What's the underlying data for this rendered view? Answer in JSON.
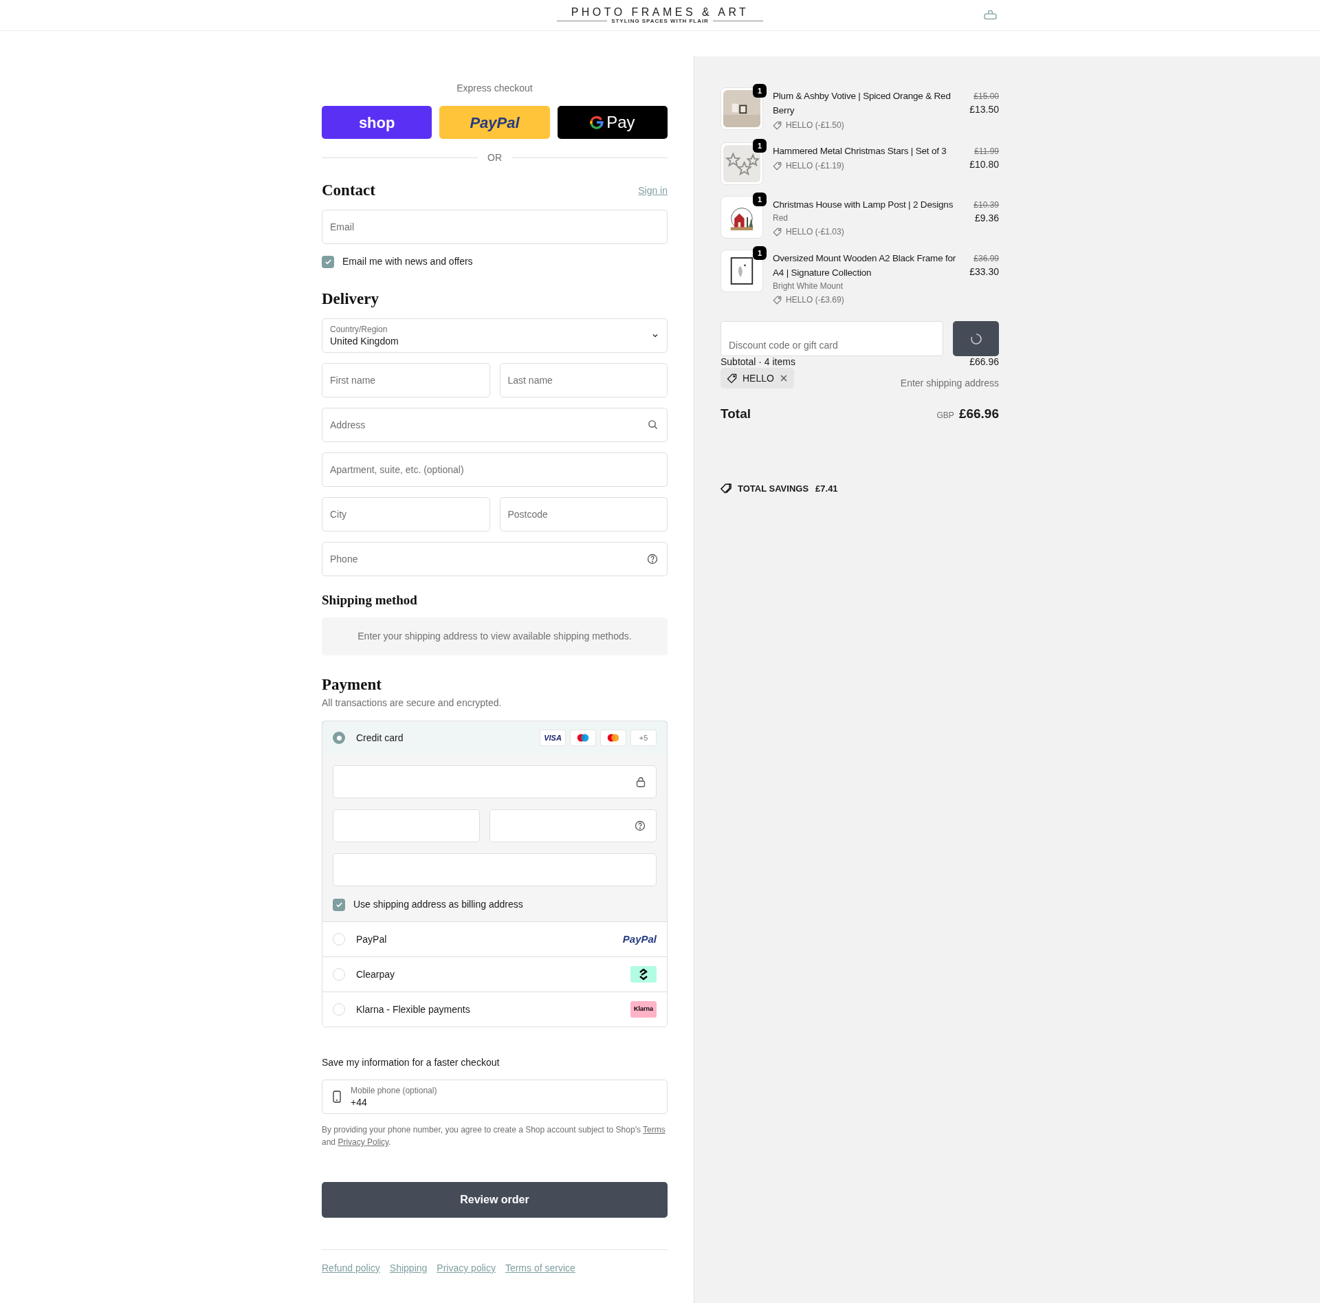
{
  "header": {
    "logo_title": "PHOTO FRAMES & ART",
    "logo_tagline": "STYLING SPACES WITH FLAIR"
  },
  "express_checkout": {
    "label": "Express checkout",
    "buttons": [
      {
        "kind": "shop",
        "label": "shop"
      },
      {
        "kind": "paypal",
        "label": "PayPal"
      },
      {
        "kind": "gpay",
        "label": "Pay"
      }
    ],
    "divider": "OR"
  },
  "contact": {
    "heading": "Contact",
    "sign_in": "Sign in",
    "email_placeholder": "Email",
    "newsletter": {
      "label": "Email me with news and offers",
      "checked": true
    }
  },
  "delivery": {
    "heading": "Delivery",
    "country": {
      "label": "Country/Region",
      "value": "United Kingdom"
    },
    "rows": [
      [
        {
          "placeholder": "First name",
          "kind": "plain"
        },
        {
          "placeholder": "Last name",
          "kind": "plain"
        }
      ],
      [
        {
          "placeholder": "Address",
          "kind": "search"
        }
      ],
      [
        {
          "placeholder": "Apartment, suite, etc. (optional)",
          "kind": "plain"
        }
      ],
      [
        {
          "placeholder": "City",
          "kind": "plain"
        },
        {
          "placeholder": "Postcode",
          "kind": "plain"
        }
      ],
      [
        {
          "placeholder": "Phone",
          "kind": "help"
        }
      ]
    ]
  },
  "shipping_method": {
    "heading": "Shipping method",
    "message": "Enter your shipping address to view available shipping methods."
  },
  "payment": {
    "heading": "Payment",
    "subtitle": "All transactions are secure and encrypted.",
    "methods": [
      {
        "kind": "card",
        "label": "Credit card",
        "selected": true,
        "badge_visa": "VISA",
        "badge_more": "+5"
      },
      {
        "kind": "paypal",
        "label": "PayPal",
        "selected": false,
        "logo": "PayPal"
      },
      {
        "kind": "clearpay",
        "label": "Clearpay",
        "selected": false
      },
      {
        "kind": "klarna",
        "label": "Klarna - Flexible payments",
        "selected": false,
        "logo": "Klarna"
      }
    ],
    "billing": {
      "label": "Use shipping address as billing address",
      "checked": true
    }
  },
  "save_info": {
    "heading": "Save my information for a faster checkout",
    "phone": {
      "label": "Mobile phone (optional)",
      "value": "+44"
    },
    "disclaimer": {
      "before": "By providing your phone number, you agree to create a Shop account subject to Shop's",
      "terms": "Terms",
      "middle": "and",
      "privacy": "Privacy Policy",
      "after": "."
    }
  },
  "review_button": "Review order",
  "footer_links": [
    "Refund policy",
    "Shipping",
    "Privacy policy",
    "Terms of service"
  ],
  "order_summary": {
    "items": [
      {
        "kind": "candle",
        "quantity": "1",
        "title": "Plum & Ashby Votive | Spiced Orange & Red Berry",
        "discount": "HELLO (-£1.50)",
        "original_price": "£15.00",
        "price": "£13.50"
      },
      {
        "kind": "stars",
        "quantity": "1",
        "title": "Hammered Metal Christmas Stars | Set of 3",
        "discount": "HELLO (-£1.19)",
        "original_price": "£11.99",
        "price": "£10.80"
      },
      {
        "kind": "house",
        "quantity": "1",
        "title": "Christmas House with Lamp Post | 2 Designs",
        "variant": "Red",
        "discount": "HELLO (-£1.03)",
        "original_price": "£10.39",
        "price": "£9.36"
      },
      {
        "kind": "frame",
        "quantity": "1",
        "title": "Oversized Mount Wooden A2 Black Frame for A4 | Signature Collection",
        "variant": "Bright White Mount",
        "discount": "HELLO (-£3.69)",
        "original_price": "£36.99",
        "price": "£33.30"
      }
    ],
    "discount_placeholder": "Discount code or gift card",
    "subtotal_label": "Subtotal · 4 items",
    "subtotal": "£66.96",
    "applied_code": "HELLO",
    "shipping_value": "Enter shipping address",
    "total_label": "Total",
    "currency": "GBP",
    "total": "£66.96",
    "savings_label": "TOTAL SAVINGS",
    "savings": "£7.41"
  }
}
